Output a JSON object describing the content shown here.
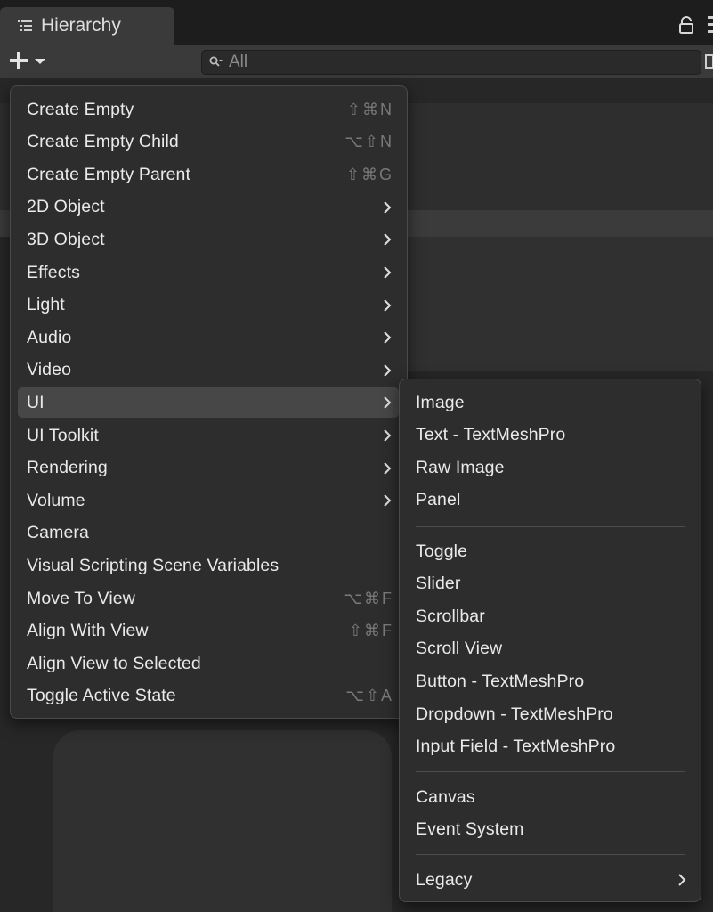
{
  "tab": {
    "title": "Hierarchy",
    "icon": "hierarchy-list-icon"
  },
  "toolbar": {
    "add_icon": "plus-icon",
    "dropdown_icon": "caret-down-icon"
  },
  "search": {
    "placeholder": "All",
    "icon": "search-icon"
  },
  "main_menu": [
    {
      "label": "Create Empty",
      "shortcut": "⇧⌘N"
    },
    {
      "label": "Create Empty Child",
      "shortcut": "⌥⇧N"
    },
    {
      "label": "Create Empty Parent",
      "shortcut": "⇧⌘G"
    },
    {
      "label": "2D Object",
      "submenu": true
    },
    {
      "label": "3D Object",
      "submenu": true
    },
    {
      "label": "Effects",
      "submenu": true
    },
    {
      "label": "Light",
      "submenu": true
    },
    {
      "label": "Audio",
      "submenu": true
    },
    {
      "label": "Video",
      "submenu": true
    },
    {
      "label": "UI",
      "submenu": true,
      "highlighted": true
    },
    {
      "label": "UI Toolkit",
      "submenu": true
    },
    {
      "label": "Rendering",
      "submenu": true
    },
    {
      "label": "Volume",
      "submenu": true
    },
    {
      "label": "Camera"
    },
    {
      "label": "Visual Scripting Scene Variables"
    },
    {
      "label": "Move To View",
      "shortcut": "⌥⌘F"
    },
    {
      "label": "Align With View",
      "shortcut": "⇧⌘F"
    },
    {
      "label": "Align View to Selected"
    },
    {
      "label": "Toggle Active State",
      "shortcut": "⌥⇧A"
    }
  ],
  "sub_menu": {
    "group1": [
      "Image",
      "Text - TextMeshPro",
      "Raw Image",
      "Panel"
    ],
    "group2": [
      "Toggle",
      "Slider",
      "Scrollbar",
      "Scroll View",
      "Button - TextMeshPro",
      "Dropdown - TextMeshPro",
      "Input Field - TextMeshPro"
    ],
    "group3": [
      "Canvas",
      "Event System"
    ],
    "group4": [
      {
        "label": "Legacy",
        "submenu": true
      }
    ]
  },
  "colors": {
    "menu_bg": "#2d2d2d",
    "highlight": "#474747",
    "text": "#eaeaea",
    "shortcut": "#7a7a7a"
  }
}
